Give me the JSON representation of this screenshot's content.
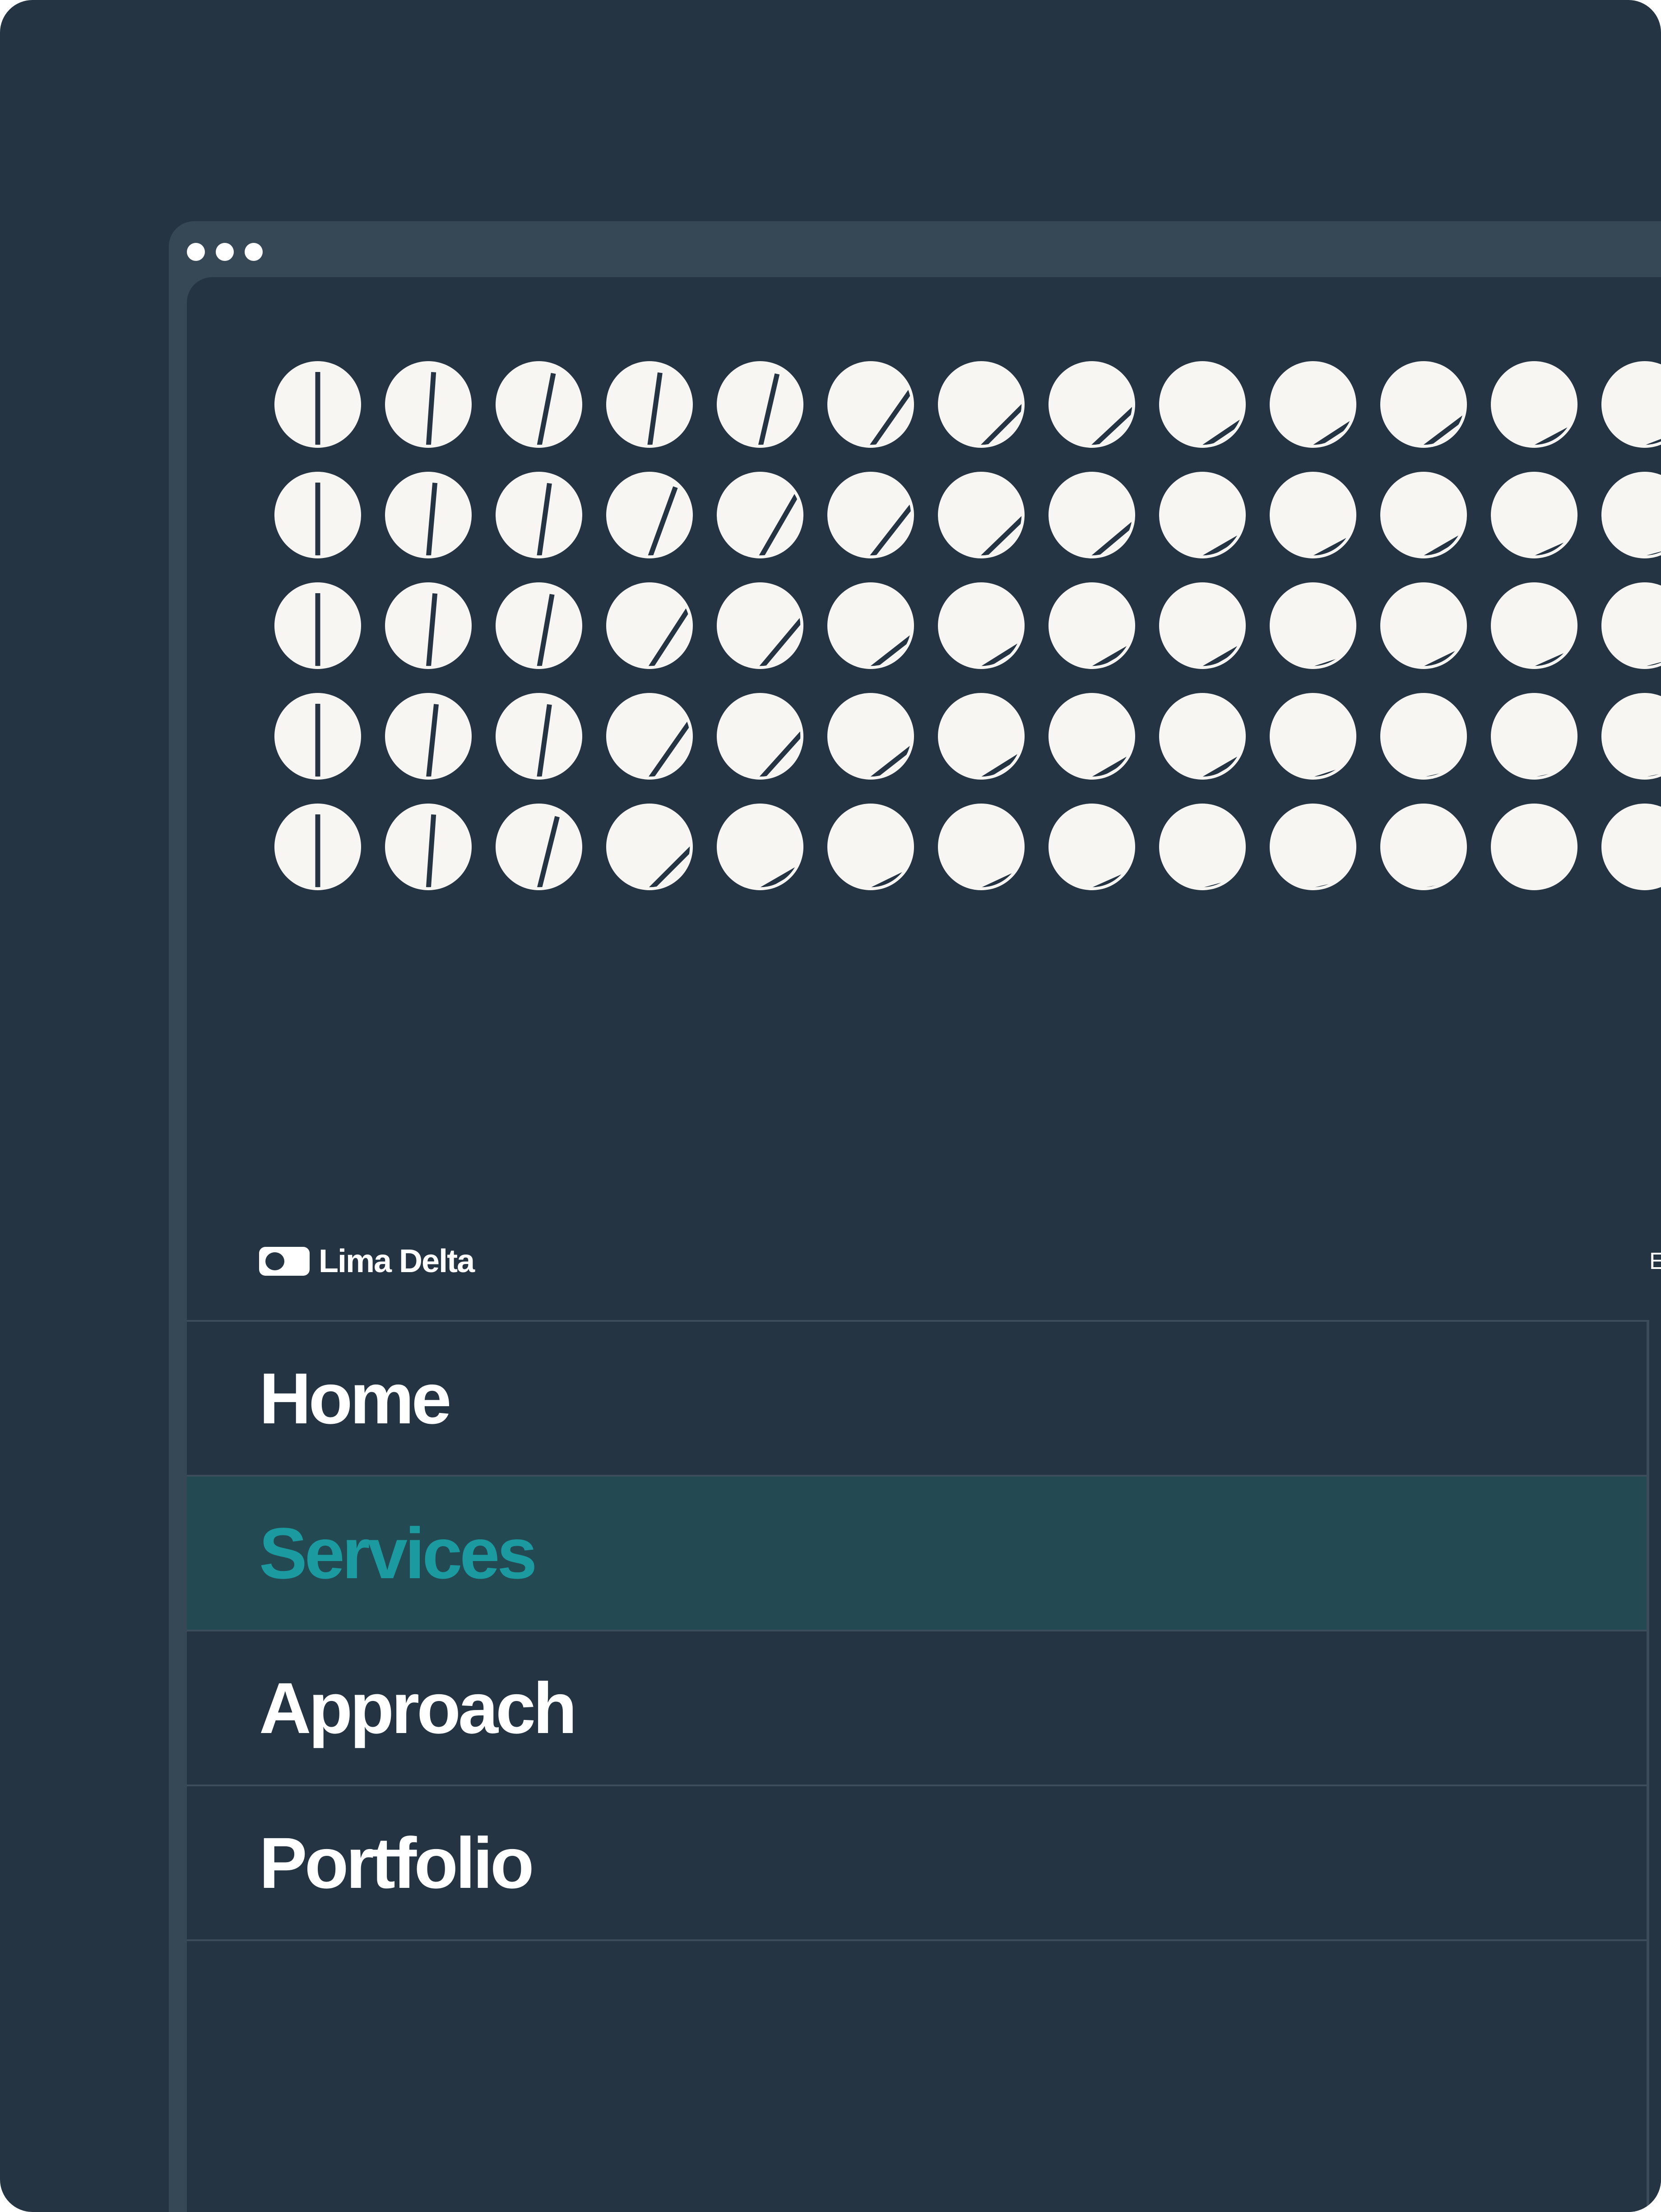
{
  "colors": {
    "background": "#243443",
    "chrome": "#364756",
    "dial_face": "#f8f6f3",
    "dial_needle": "#243443",
    "accent": "#1b9aa0",
    "active_row": "#234953",
    "divider": "#3c4c5a"
  },
  "window": {
    "controls": [
      "dot-icon",
      "dot-icon",
      "dot-icon"
    ]
  },
  "brand": {
    "logo_icon": "toggle-pill-icon",
    "name": "Lima Delta",
    "edge_text": "E"
  },
  "menu": {
    "items": [
      {
        "label": "Home",
        "active": false
      },
      {
        "label": "Services",
        "active": true
      },
      {
        "label": "Approach",
        "active": false
      },
      {
        "label": "Portfolio",
        "active": false
      }
    ]
  },
  "pattern": {
    "icon": "dial-icon",
    "rows": 5,
    "columns": 13,
    "needle_angles_deg": [
      [
        0,
        4,
        11,
        8,
        13,
        35,
        45,
        47,
        56,
        57,
        53,
        62,
        69
      ],
      [
        0,
        5,
        8,
        20,
        30,
        38,
        46,
        50,
        60,
        62,
        60,
        66,
        75
      ],
      [
        0,
        5,
        10,
        33,
        40,
        52,
        58,
        60,
        60,
        72,
        64,
        66,
        75
      ],
      [
        0,
        6,
        8,
        35,
        42,
        52,
        58,
        60,
        60,
        72,
        77,
        78,
        78
      ],
      [
        0,
        4,
        14,
        45,
        60,
        64,
        65,
        66,
        75,
        77,
        79,
        84,
        84
      ]
    ]
  }
}
